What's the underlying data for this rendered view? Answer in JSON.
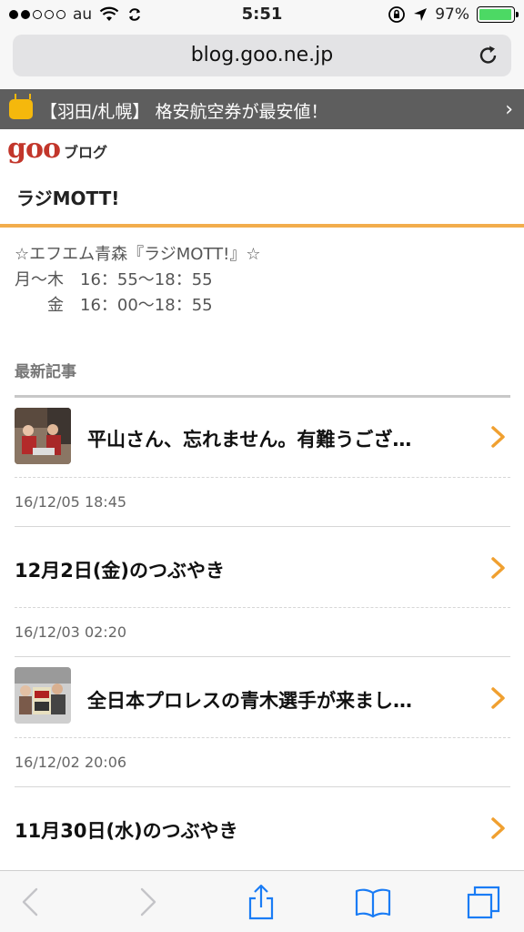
{
  "status_bar": {
    "carrier": "au",
    "time": "5:51",
    "battery_percent": "97%",
    "battery_level": 0.97,
    "signal_filled": 2,
    "signal_total": 5
  },
  "url_bar": {
    "url": "blog.goo.ne.jp"
  },
  "ad_banner": {
    "text": "【羽田/札幌】 格安航空券が最安値！"
  },
  "goo_header": {
    "logo": "goo",
    "subtitle": "ブログ"
  },
  "blog": {
    "title": "ラジMOTT!",
    "description_lines": [
      "☆エフエム青森『ラジMOTT!』☆",
      "月〜木　16：55〜18：55",
      "　　金　16：00〜18：55"
    ]
  },
  "latest": {
    "label": "最新記事",
    "entries": [
      {
        "title": "平山さん、忘れません。有難うござ…",
        "date": "16/12/05 18:45",
        "has_thumb": true
      },
      {
        "title": "12月2日(金)のつぶやき",
        "date": "16/12/03 02:20",
        "has_thumb": false
      },
      {
        "title": "全日本プロレスの青木選手が来まし…",
        "date": "16/12/02 20:06",
        "has_thumb": true
      },
      {
        "title": "11月30日(水)のつぶやき",
        "date": "",
        "has_thumb": false
      }
    ]
  },
  "colors": {
    "accent_orange": "#f2ad4c",
    "arrow_orange": "#f0a030",
    "goo_red": "#c2362b",
    "ios_blue": "#1a7cf5"
  }
}
